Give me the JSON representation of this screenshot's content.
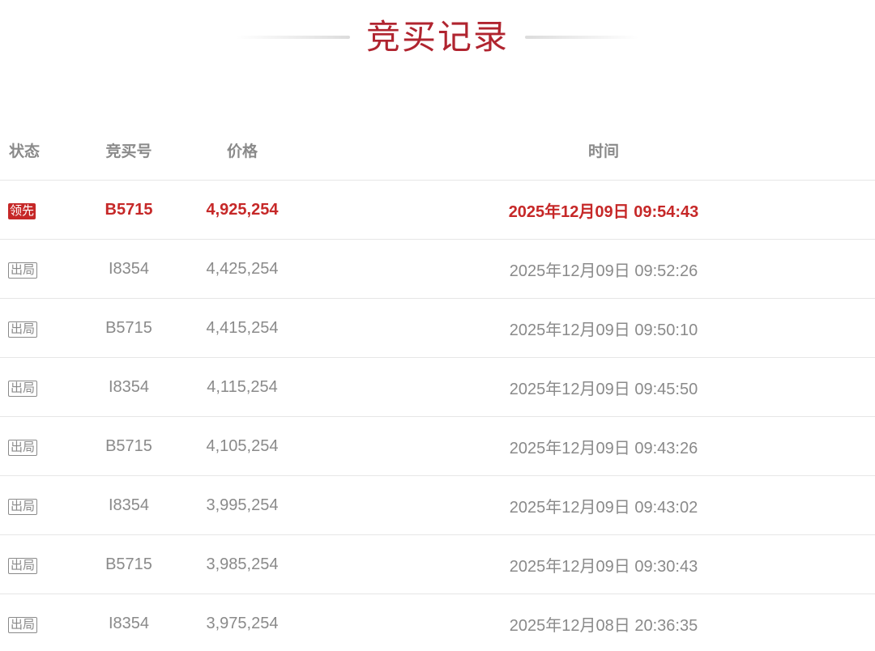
{
  "title": "竞买记录",
  "table": {
    "headers": {
      "status": "状态",
      "bidder": "竞买号",
      "price": "价格",
      "time": "时间"
    },
    "rows": [
      {
        "status": "领先",
        "bidder": "B5715",
        "price": "4,925,254",
        "time": "2025年12月09日  09:54:43",
        "leading": true
      },
      {
        "status": "出局",
        "bidder": "I8354",
        "price": "4,425,254",
        "time": "2025年12月09日  09:52:26",
        "leading": false
      },
      {
        "status": "出局",
        "bidder": "B5715",
        "price": "4,415,254",
        "time": "2025年12月09日  09:50:10",
        "leading": false
      },
      {
        "status": "出局",
        "bidder": "I8354",
        "price": "4,115,254",
        "time": "2025年12月09日  09:45:50",
        "leading": false
      },
      {
        "status": "出局",
        "bidder": "B5715",
        "price": "4,105,254",
        "time": "2025年12月09日  09:43:26",
        "leading": false
      },
      {
        "status": "出局",
        "bidder": "I8354",
        "price": "3,995,254",
        "time": "2025年12月09日  09:43:02",
        "leading": false
      },
      {
        "status": "出局",
        "bidder": "B5715",
        "price": "3,985,254",
        "time": "2025年12月09日  09:30:43",
        "leading": false
      },
      {
        "status": "出局",
        "bidder": "I8354",
        "price": "3,975,254",
        "time": "2025年12月08日  20:36:35",
        "leading": false
      }
    ]
  },
  "colors": {
    "accent": "#b0242f",
    "lead": "#c62828",
    "muted": "#8a8a8a",
    "divider": "#e6e6e6"
  }
}
